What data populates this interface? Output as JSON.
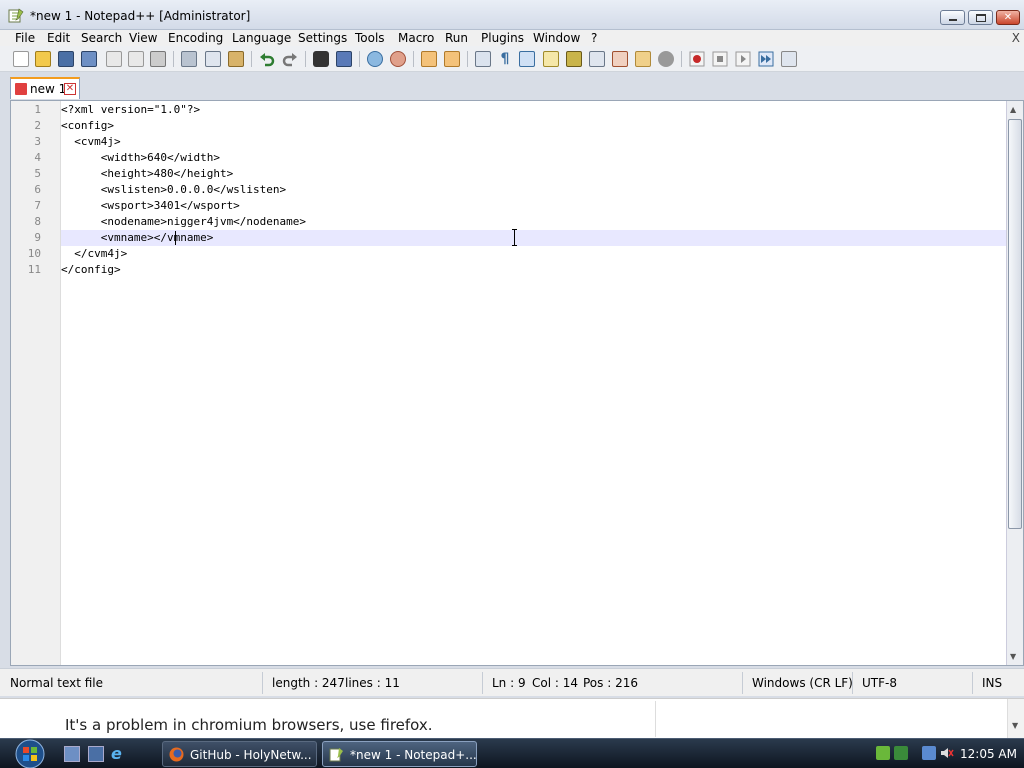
{
  "window": {
    "title": "*new 1 - Notepad++ [Administrator]"
  },
  "menu": {
    "items": [
      "File",
      "Edit",
      "Search",
      "View",
      "Encoding",
      "Language",
      "Settings",
      "Tools",
      "Macro",
      "Run",
      "Plugins",
      "Window",
      "?"
    ],
    "close_label": "X"
  },
  "tabs": [
    {
      "label": "new 1",
      "active": true
    }
  ],
  "editor": {
    "lines": [
      {
        "number": "1",
        "text": "<?xml version=\"1.0\"?>"
      },
      {
        "number": "2",
        "text": "<config>"
      },
      {
        "number": "3",
        "text": "  <cvm4j>"
      },
      {
        "number": "4",
        "text": "      <width>640</width>"
      },
      {
        "number": "5",
        "text": "      <height>480</height>"
      },
      {
        "number": "6",
        "text": "      <wslisten>0.0.0.0</wslisten>"
      },
      {
        "number": "7",
        "text": "      <wsport>3401</wsport>"
      },
      {
        "number": "8",
        "text": "      <nodename>nigger4jvm</nodename>"
      },
      {
        "number": "9",
        "text": "      <vmname></vmname>"
      },
      {
        "number": "10",
        "text": "  </cvm4j>"
      },
      {
        "number": "11",
        "text": "</config>"
      }
    ],
    "current_line": 9
  },
  "status": {
    "file_type": "Normal text file",
    "length": "length : 247",
    "lines": "lines : 11",
    "ln": "Ln : 9",
    "col": "Col : 14",
    "pos": "Pos : 216",
    "eol": "Windows (CR LF)",
    "encoding": "UTF-8",
    "mode": "INS"
  },
  "background_page": {
    "text": "It's a problem in chromium browsers, use firefox."
  },
  "taskbar": {
    "tasks": [
      {
        "label": "GitHub - HolyNetw...",
        "active": false
      },
      {
        "label": "*new 1 - Notepad+...",
        "active": true
      }
    ],
    "clock": "12:05 AM"
  },
  "colors": {
    "tab_accent": "#f39c1f",
    "current_line_bg": "#e8e8ff",
    "taskbar": "#1a2534"
  }
}
